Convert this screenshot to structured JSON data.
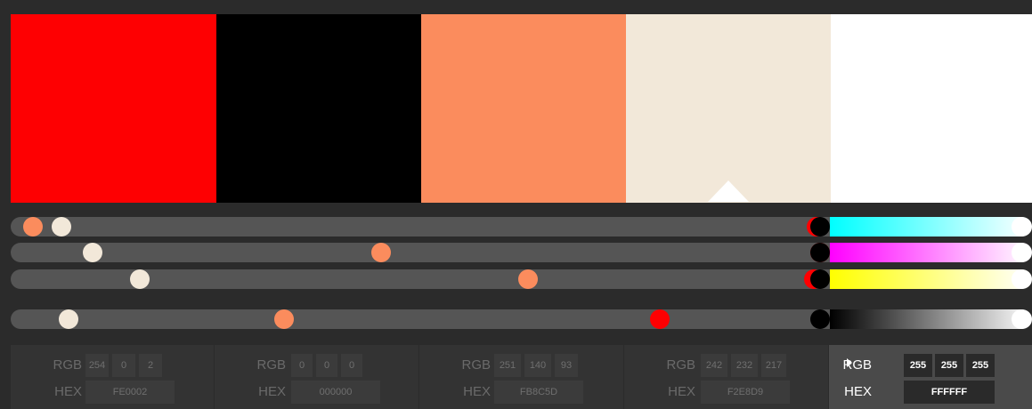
{
  "swatches": [
    {
      "name": "swatch-red",
      "color": "#FE0002"
    },
    {
      "name": "swatch-black",
      "color": "#000000"
    },
    {
      "name": "swatch-salmon",
      "color": "#FB8C5D"
    },
    {
      "name": "swatch-cream",
      "color": "#F2E8D9"
    },
    {
      "name": "swatch-white",
      "color": "#FFFFFF"
    }
  ],
  "selected_swatch_index": 4,
  "slider_rows": [
    {
      "name": "cyan",
      "gradient": [
        "#00ffff",
        "#ffffff"
      ],
      "levels": [
        0.996,
        1.0,
        0.016,
        0.051,
        0.0
      ]
    },
    {
      "name": "magenta",
      "gradient": [
        "#ff00ff",
        "#ffffff"
      ],
      "levels": [
        1.0,
        1.0,
        0.451,
        0.09,
        0.0
      ]
    },
    {
      "name": "yellow",
      "gradient": [
        "#ffff00",
        "#ffffff"
      ],
      "levels": [
        0.992,
        1.0,
        0.635,
        0.149,
        0.0
      ]
    },
    {
      "name": "brightness",
      "gradient": [
        "#000000",
        "#ffffff"
      ],
      "levels": [
        0.8,
        1.0,
        0.33,
        0.06,
        0.0
      ]
    }
  ],
  "labels": {
    "rgb": "RGB",
    "hex": "HEX"
  },
  "colors": [
    {
      "r": "254",
      "g": "0",
      "b": "2",
      "hex": "FE0002"
    },
    {
      "r": "0",
      "g": "0",
      "b": "0",
      "hex": "000000"
    },
    {
      "r": "251",
      "g": "140",
      "b": "93",
      "hex": "FB8C5D"
    },
    {
      "r": "242",
      "g": "232",
      "b": "217",
      "hex": "F2E8D9"
    },
    {
      "r": "255",
      "g": "255",
      "b": "255",
      "hex": "FFFFFF"
    }
  ]
}
